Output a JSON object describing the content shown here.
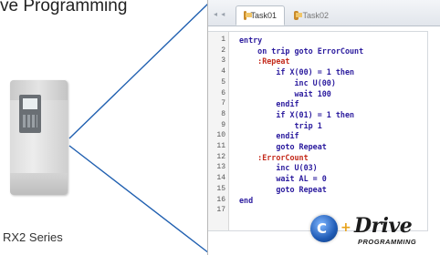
{
  "header": {
    "title": "ve Programming"
  },
  "device": {
    "caption": "RX2 Series"
  },
  "tabs": [
    {
      "label": "Task01",
      "active": true
    },
    {
      "label": "Task02",
      "active": false
    }
  ],
  "editor": {
    "line_numbers": [
      "1",
      "2",
      "3",
      "4",
      "5",
      "6",
      "7",
      "8",
      "9",
      "10",
      "11",
      "12",
      "13",
      "14",
      "15",
      "16",
      "17"
    ],
    "lines": [
      "entry",
      "    on trip goto ErrorCount",
      "    :Repeat",
      "        if X(00) = 1 then",
      "            inc U(00)",
      "            wait 100",
      "        endif",
      "        if X(01) = 1 then",
      "            trip 1",
      "        endif",
      "        goto Repeat",
      "    :ErrorCount",
      "        inc U(03)",
      "        wait AL = 0",
      "        goto Repeat",
      "end",
      ""
    ]
  },
  "logo": {
    "mark": "C",
    "plus": "+",
    "word": "Drive",
    "sub": "PROGRAMMING"
  },
  "colors": {
    "keyword": "#2b1b9e",
    "label": "#c42b1c",
    "callout_line": "#1f5fb0"
  }
}
